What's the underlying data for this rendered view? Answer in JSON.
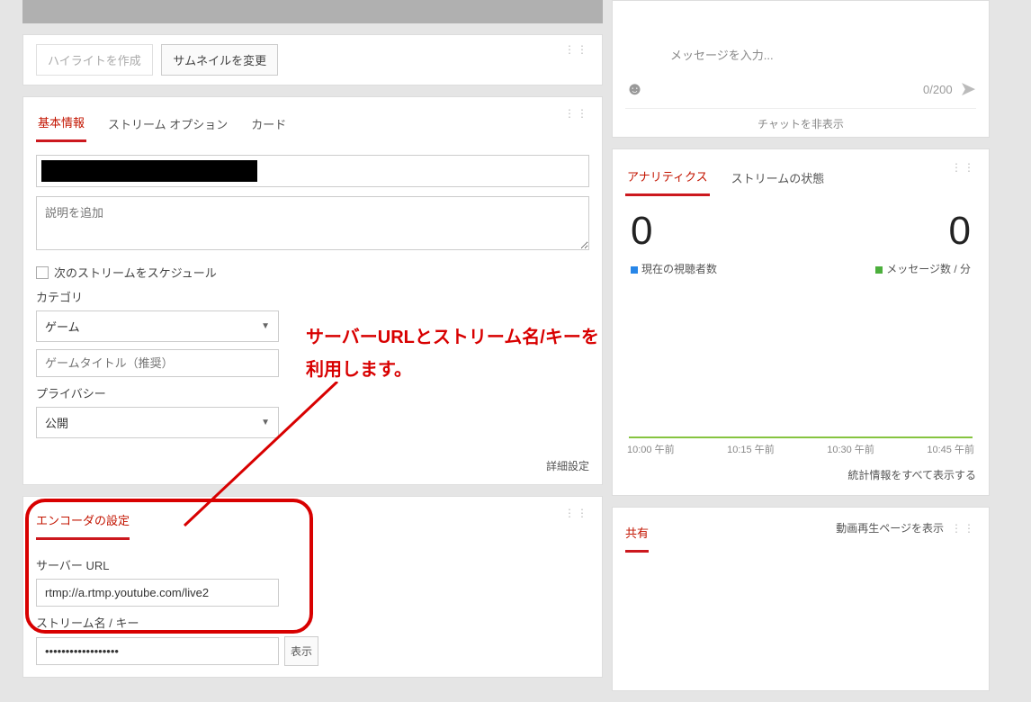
{
  "toolbar": {
    "create_highlight": "ハイライトを作成",
    "change_thumbnail": "サムネイルを変更"
  },
  "tabs": {
    "basic": "基本情報",
    "stream_options": "ストリーム オプション",
    "cards": "カード"
  },
  "form": {
    "description_placeholder": "説明を追加",
    "schedule_next": "次のストリームをスケジュール",
    "category_label": "カテゴリ",
    "category_value": "ゲーム",
    "game_title_placeholder": "ゲームタイトル（推奨）",
    "privacy_label": "プライバシー",
    "privacy_value": "公開",
    "advanced": "詳細設定"
  },
  "encoder": {
    "title": "エンコーダの設定",
    "server_url_label": "サーバー URL",
    "server_url_value": "rtmp://a.rtmp.youtube.com/live2",
    "stream_key_label": "ストリーム名 / キー",
    "stream_key_value": "••••••••••••••••••",
    "show_btn": "表示"
  },
  "annotation": {
    "line1": "サーバーURLとストリーム名/キーを",
    "line2": "利用します。"
  },
  "chat": {
    "placeholder": "メッセージを入力...",
    "counter": "0/200",
    "hide": "チャットを非表示"
  },
  "analytics": {
    "tab_analytics": "アナリティクス",
    "tab_status": "ストリームの状態",
    "viewers_num": "0",
    "messages_num": "0",
    "viewers_label": "現在の視聴者数",
    "messages_label": "メッセージ数 / 分",
    "ticks": [
      "10:00 午前",
      "10:15 午前",
      "10:30 午前",
      "10:45 午前"
    ],
    "footer": "統計情報をすべて表示する"
  },
  "share": {
    "title": "共有",
    "link": "動画再生ページを表示"
  }
}
